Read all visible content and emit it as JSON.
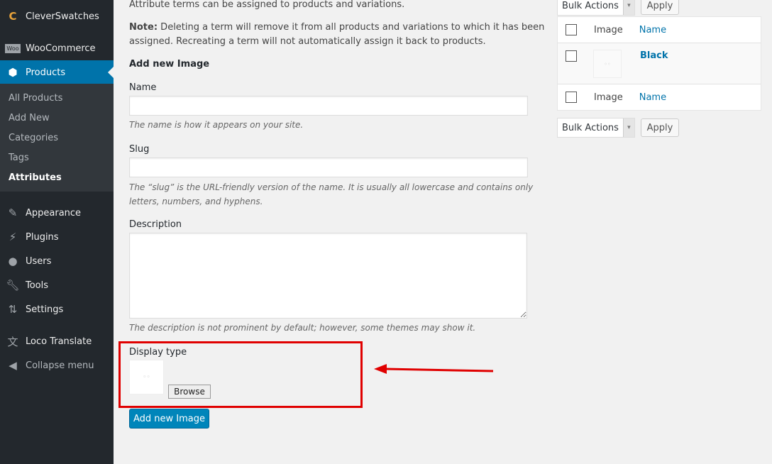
{
  "sidebar": {
    "items": [
      {
        "label": "CleverSwatches",
        "icon": "cleverswatches-logo-icon"
      },
      {
        "label": "WooCommerce",
        "icon": "woocommerce-icon"
      },
      {
        "label": "Products",
        "icon": "products-box-icon"
      },
      {
        "label": "Appearance",
        "icon": "brush-icon"
      },
      {
        "label": "Plugins",
        "icon": "plugin-icon"
      },
      {
        "label": "Users",
        "icon": "user-icon"
      },
      {
        "label": "Tools",
        "icon": "wrench-icon"
      },
      {
        "label": "Settings",
        "icon": "settings-icon"
      },
      {
        "label": "Loco Translate",
        "icon": "translate-icon"
      },
      {
        "label": "Collapse menu",
        "icon": "collapse-icon"
      }
    ],
    "submenu": [
      "All Products",
      "Add New",
      "Categories",
      "Tags",
      "Attributes"
    ]
  },
  "main": {
    "intro": "Attribute terms can be assigned to products and variations.",
    "note_bold": "Note:",
    "note": " Deleting a term will remove it from all products and variations to which it has been assigned. Recreating a term will not automatically assign it back to products.",
    "heading": "Add new Image",
    "name_label": "Name",
    "name_hint": "The name is how it appears on your site.",
    "slug_label": "Slug",
    "slug_hint": "The “slug” is the URL-friendly version of the name. It is usually all lowercase and contains only letters, numbers, and hyphens.",
    "desc_label": "Description",
    "desc_hint": "The description is not prominent by default; however, some themes may show it.",
    "display_label": "Display type",
    "browse": "Browse",
    "submit": "Add new Image"
  },
  "table": {
    "bulk": "Bulk Actions",
    "apply": "Apply",
    "col_image": "Image",
    "col_name": "Name",
    "rows": [
      {
        "name": "Black"
      }
    ]
  },
  "colors": {
    "accent": "#0073aa",
    "highlight": "#e00000"
  }
}
